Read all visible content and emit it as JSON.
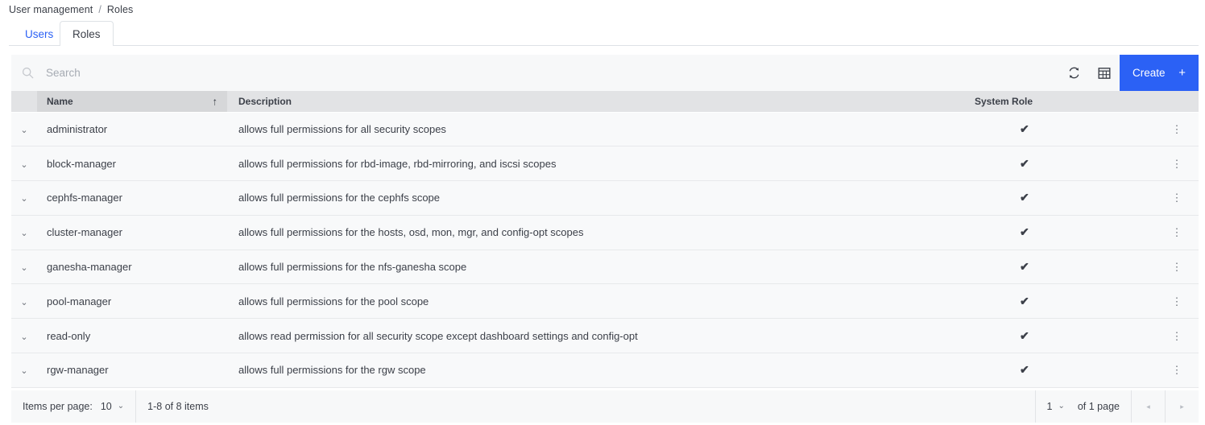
{
  "breadcrumb": {
    "items": [
      "User management",
      "Roles"
    ],
    "separator": "/"
  },
  "tabs": [
    {
      "label": "Users",
      "active": false
    },
    {
      "label": "Roles",
      "active": true
    }
  ],
  "toolbar": {
    "search_placeholder": "Search",
    "search_value": "",
    "refresh_title": "Refresh",
    "columns_title": "Table settings",
    "create_label": "Create",
    "create_plus": "+",
    "create_color": "#2b61f5"
  },
  "table": {
    "columns": [
      {
        "key": "expand",
        "label": ""
      },
      {
        "key": "name",
        "label": "Name",
        "sorted": true,
        "sort_icon": "↑"
      },
      {
        "key": "description",
        "label": "Description"
      },
      {
        "key": "system_role",
        "label": "System Role"
      },
      {
        "key": "actions",
        "label": ""
      }
    ],
    "expand_icon": "⌄",
    "check_icon": "✔",
    "kebab_icon": "⋮",
    "rows": [
      {
        "name": "administrator",
        "description": "allows full permissions for all security scopes",
        "system_role": true
      },
      {
        "name": "block-manager",
        "description": "allows full permissions for rbd-image, rbd-mirroring, and iscsi scopes",
        "system_role": true
      },
      {
        "name": "cephfs-manager",
        "description": "allows full permissions for the cephfs scope",
        "system_role": true
      },
      {
        "name": "cluster-manager",
        "description": "allows full permissions for the hosts, osd, mon, mgr, and config-opt scopes",
        "system_role": true
      },
      {
        "name": "ganesha-manager",
        "description": "allows full permissions for the nfs-ganesha scope",
        "system_role": true
      },
      {
        "name": "pool-manager",
        "description": "allows full permissions for the pool scope",
        "system_role": true
      },
      {
        "name": "read-only",
        "description": "allows read permission for all security scope except dashboard settings and config-opt",
        "system_role": true
      },
      {
        "name": "rgw-manager",
        "description": "allows full permissions for the rgw scope",
        "system_role": true
      }
    ]
  },
  "footer": {
    "items_per_page_label": "Items per page:",
    "items_per_page_value": "10",
    "range_text": "1-8 of 8 items",
    "page_value": "1",
    "of_pages_text": "of 1 page",
    "prev_icon": "◂",
    "next_icon": "▸",
    "caret_icon": "⌄"
  }
}
